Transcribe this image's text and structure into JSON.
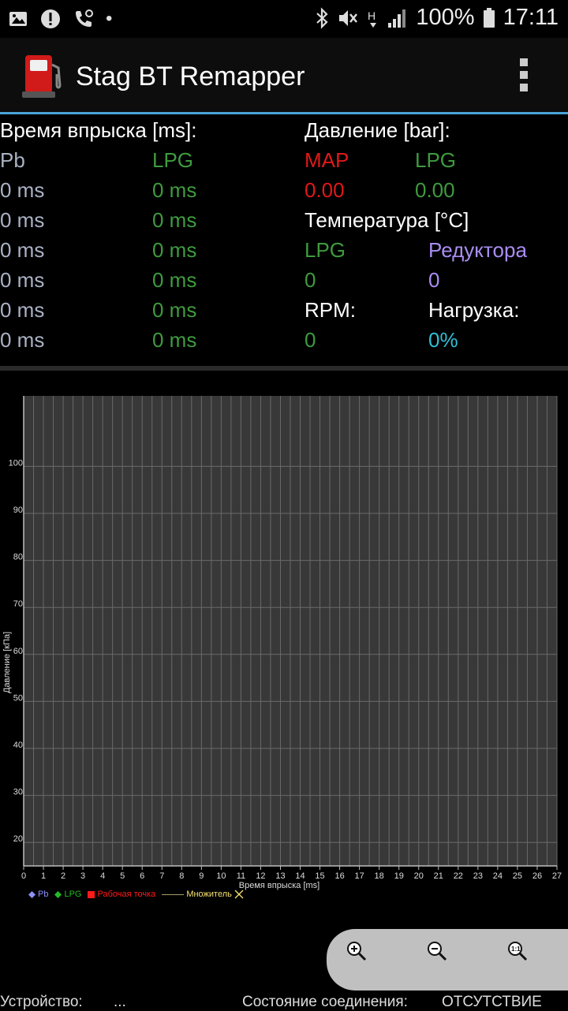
{
  "status_bar": {
    "icons_left": [
      "image-icon",
      "alert-icon",
      "phone-icon",
      "dot-icon"
    ],
    "icons_right": [
      "bluetooth-icon",
      "mute-icon",
      "network-h-icon",
      "signal-icon",
      "battery-icon"
    ],
    "battery": "100%",
    "time": "17:11"
  },
  "app_bar": {
    "title": "Stag BT Remapper",
    "accent_color": "#4aa3d9"
  },
  "injection": {
    "header": "Время впрыска [ms]:",
    "col_pb": "Pb",
    "col_lpg": "LPG",
    "rows": [
      {
        "pb": "0 ms",
        "lpg": "0 ms"
      },
      {
        "pb": "0 ms",
        "lpg": "0 ms"
      },
      {
        "pb": "0 ms",
        "lpg": "0 ms"
      },
      {
        "pb": "0 ms",
        "lpg": "0 ms"
      },
      {
        "pb": "0 ms",
        "lpg": "0 ms"
      },
      {
        "pb": "0 ms",
        "lpg": "0 ms"
      }
    ]
  },
  "pressure": {
    "header": "Давление [bar]:",
    "map_label": "MAP",
    "lpg_label": "LPG",
    "map_value": "0.00",
    "lpg_value": "0.00"
  },
  "temperature": {
    "header": "Температура [°C]",
    "lpg_label": "LPG",
    "reducer_label": "Редуктора",
    "lpg_value": "0",
    "reducer_value": "0"
  },
  "rpm": {
    "label": "RPM:",
    "value": "0"
  },
  "load": {
    "label": "Нагрузка:",
    "value": "0%"
  },
  "chart_data": {
    "type": "scatter",
    "xlabel": "Время впрыска [ms]",
    "ylabel": "Давление [кПа]",
    "xlim": [
      0,
      27
    ],
    "ylim": [
      15,
      115
    ],
    "x_ticks": [
      0,
      1,
      2,
      3,
      4,
      5,
      6,
      7,
      8,
      9,
      10,
      11,
      12,
      13,
      14,
      15,
      16,
      17,
      18,
      19,
      20,
      21,
      22,
      23,
      24,
      25,
      26,
      27
    ],
    "y_ticks": [
      20,
      30,
      40,
      50,
      60,
      70,
      80,
      90,
      100
    ],
    "grid": true,
    "series": [
      {
        "name": "Pb",
        "values": [],
        "color": "#8f8fff",
        "marker": "diamond"
      },
      {
        "name": "LPG",
        "values": [],
        "color": "#22bb22",
        "marker": "diamond"
      },
      {
        "name": "Рабочая точка",
        "values": [],
        "color": "#ff1a1a",
        "marker": "square"
      },
      {
        "name": "Множитель",
        "values": [],
        "color": "#f5e070",
        "marker": "line"
      }
    ],
    "legend_position": "bottom-left"
  },
  "zoom": {
    "buttons": [
      "zoom-in-icon",
      "zoom-out-icon",
      "zoom-reset-icon"
    ]
  },
  "footer": {
    "device_label": "Устройство:",
    "device_value": "...",
    "connection_label": "Состояние соединения:",
    "connection_value": "ОТСУТСТВИЕ"
  }
}
